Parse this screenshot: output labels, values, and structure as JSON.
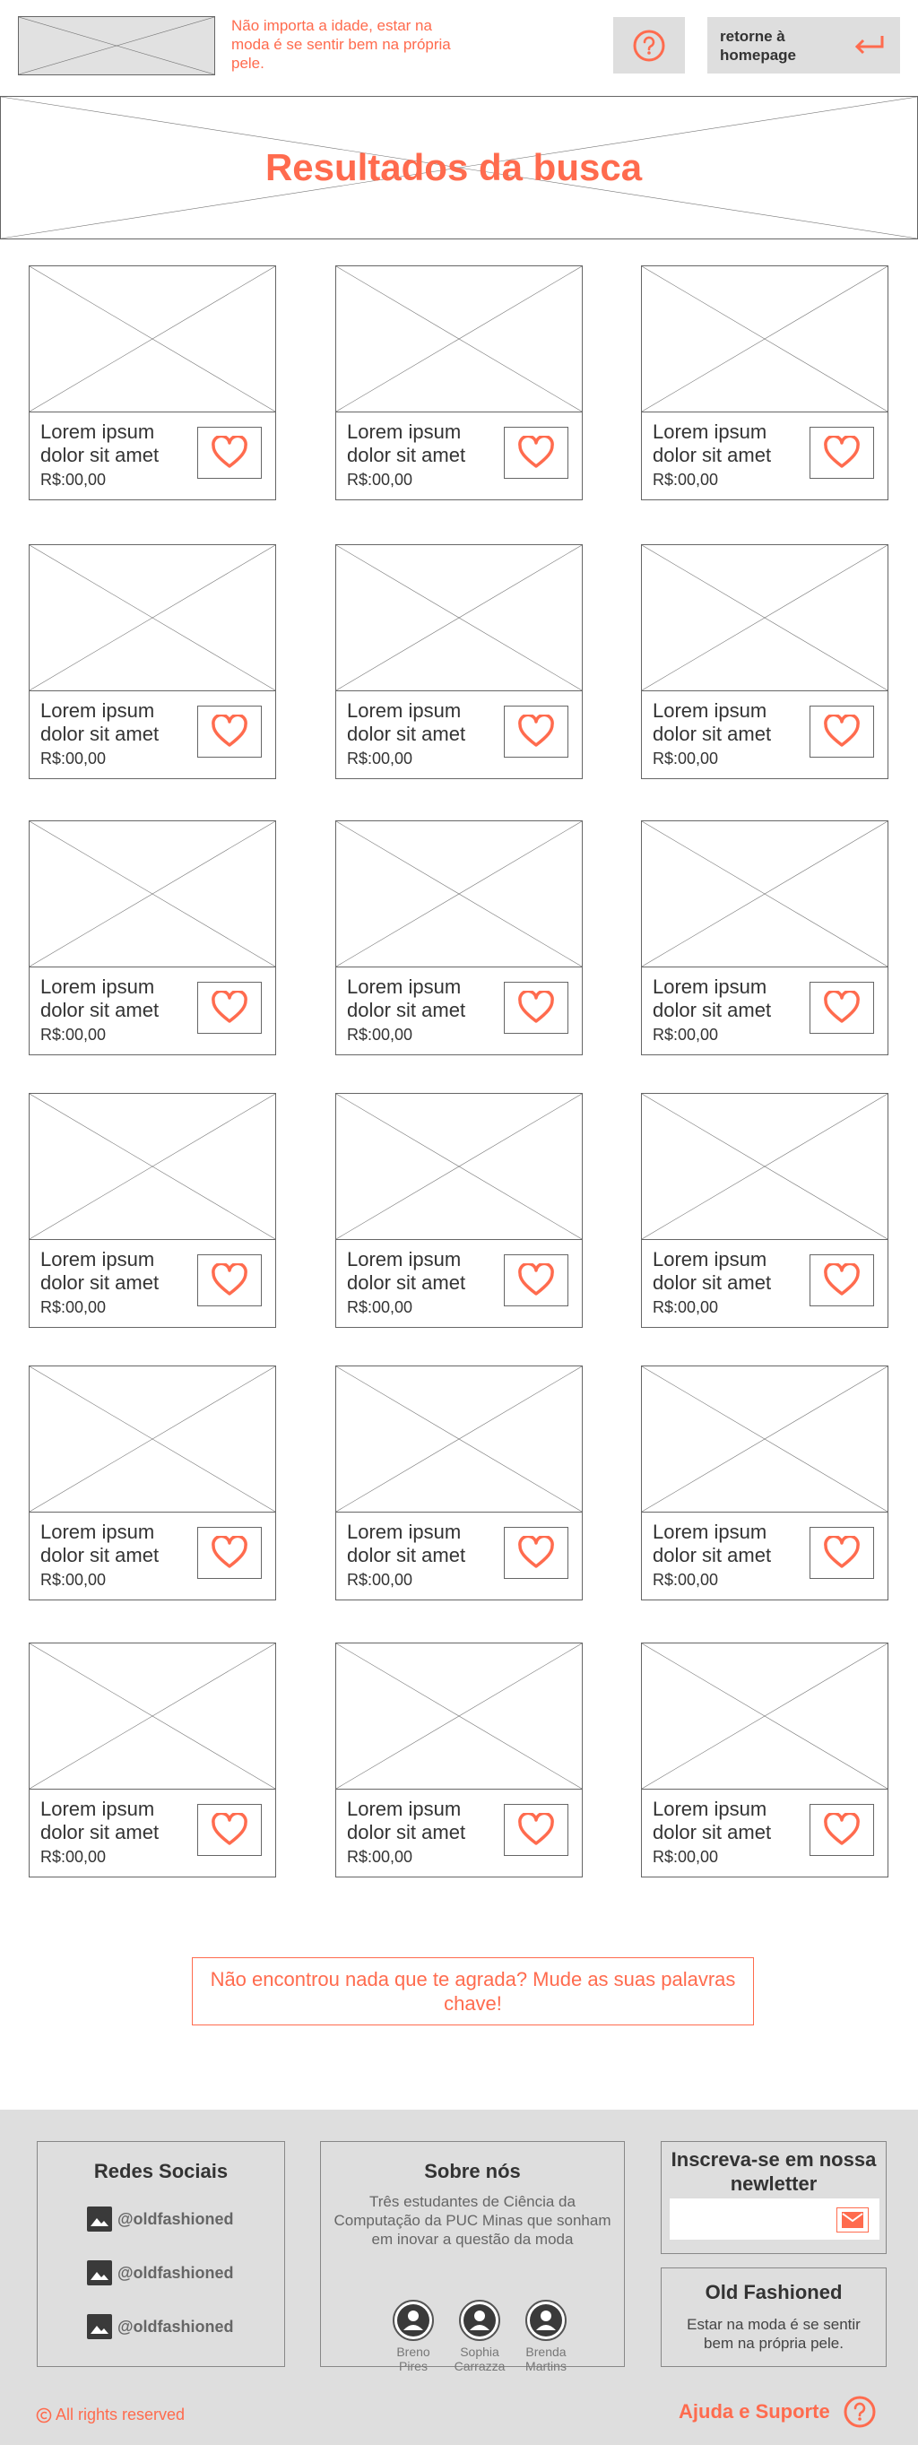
{
  "header": {
    "logo_icon": "image-placeholder",
    "tagline": "Não importa a idade, estar na moda é se sentir bem na própria pele.",
    "help_icon": "question-circle-icon",
    "home_button_label": "retorne à homepage",
    "home_icon": "return-arrow-icon"
  },
  "banner": {
    "title": "Resultados da busca"
  },
  "products": [
    {
      "name": "Lorem ipsum dolor sit amet",
      "price": "R$:00,00"
    },
    {
      "name": "Lorem ipsum dolor sit amet",
      "price": "R$:00,00"
    },
    {
      "name": "Lorem ipsum dolor sit amet",
      "price": "R$:00,00"
    },
    {
      "name": "Lorem ipsum dolor sit amet",
      "price": "R$:00,00"
    },
    {
      "name": "Lorem ipsum dolor sit amet",
      "price": "R$:00,00"
    },
    {
      "name": "Lorem ipsum dolor sit amet",
      "price": "R$:00,00"
    },
    {
      "name": "Lorem ipsum dolor sit amet",
      "price": "R$:00,00"
    },
    {
      "name": "Lorem ipsum dolor sit amet",
      "price": "R$:00,00"
    },
    {
      "name": "Lorem ipsum dolor sit amet",
      "price": "R$:00,00"
    },
    {
      "name": "Lorem ipsum dolor sit amet",
      "price": "R$:00,00"
    },
    {
      "name": "Lorem ipsum dolor sit amet",
      "price": "R$:00,00"
    },
    {
      "name": "Lorem ipsum dolor sit amet",
      "price": "R$:00,00"
    },
    {
      "name": "Lorem ipsum dolor sit amet",
      "price": "R$:00,00"
    },
    {
      "name": "Lorem ipsum dolor sit amet",
      "price": "R$:00,00"
    },
    {
      "name": "Lorem ipsum dolor sit amet",
      "price": "R$:00,00"
    },
    {
      "name": "Lorem ipsum dolor sit amet",
      "price": "R$:00,00"
    },
    {
      "name": "Lorem ipsum dolor sit amet",
      "price": "R$:00,00"
    },
    {
      "name": "Lorem ipsum dolor sit amet",
      "price": "R$:00,00"
    }
  ],
  "not_found_message": "Não encontrou nada que te agrada? Mude as suas palavras chave!",
  "footer": {
    "social": {
      "title": "Redes Sociais",
      "items": [
        "@oldfashioned",
        "@oldfashioned",
        "@oldfashioned"
      ]
    },
    "about": {
      "title": "Sobre nós",
      "text": "Três estudantes de Ciência da Computação da PUC Minas que sonham em inovar a questão da moda",
      "people": [
        "Breno Pires",
        "Sophia Carrazza",
        "Brenda Martins"
      ]
    },
    "newsletter": {
      "title": "Inscreva-se em nossa newletter",
      "email_placeholder": ""
    },
    "brand": {
      "title": "Old Fashioned",
      "text": "Estar na moda é se sentir bem na própria pele."
    },
    "rights": "All rights reserved",
    "support": "Ajuda e Suporte"
  },
  "colors": {
    "accent": "#ff6b4e",
    "footer_bg": "#dedede"
  }
}
